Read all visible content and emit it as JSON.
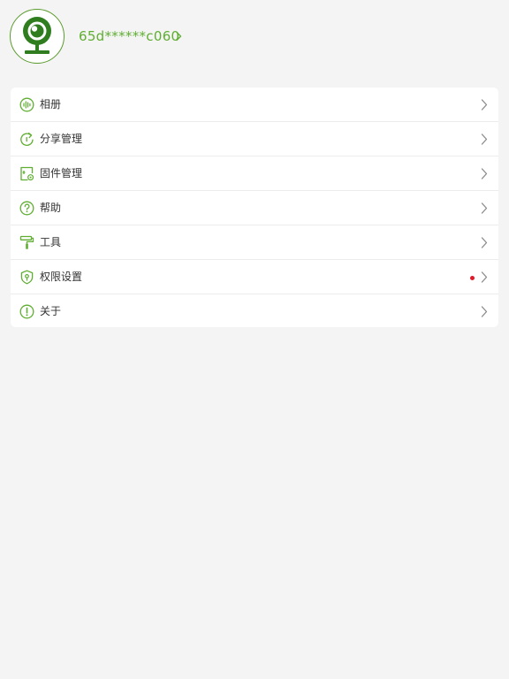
{
  "colors": {
    "accent": "#5fae32",
    "accent_dark": "#2f7d1f",
    "chevron": "#8a8a8a",
    "notification_dot": "#e0192b",
    "background": "#f4f4f4"
  },
  "profile": {
    "avatar_icon": "webcam-icon",
    "user_id": "65d******c060",
    "chevron_icon": "chevron-right-icon"
  },
  "menu": {
    "items": [
      {
        "key": "album",
        "label": "相册",
        "icon": "album-icon",
        "badge": false
      },
      {
        "key": "share-management",
        "label": "分享管理",
        "icon": "share-icon",
        "badge": false
      },
      {
        "key": "firmware-management",
        "label": "固件管理",
        "icon": "firmware-icon",
        "badge": false
      },
      {
        "key": "help",
        "label": "帮助",
        "icon": "question-icon",
        "badge": false
      },
      {
        "key": "tools",
        "label": "工具",
        "icon": "paint-roller-icon",
        "badge": false
      },
      {
        "key": "permission-settings",
        "label": "权限设置",
        "icon": "shield-icon",
        "badge": true
      },
      {
        "key": "about",
        "label": "关于",
        "icon": "exclamation-icon",
        "badge": false
      }
    ]
  }
}
